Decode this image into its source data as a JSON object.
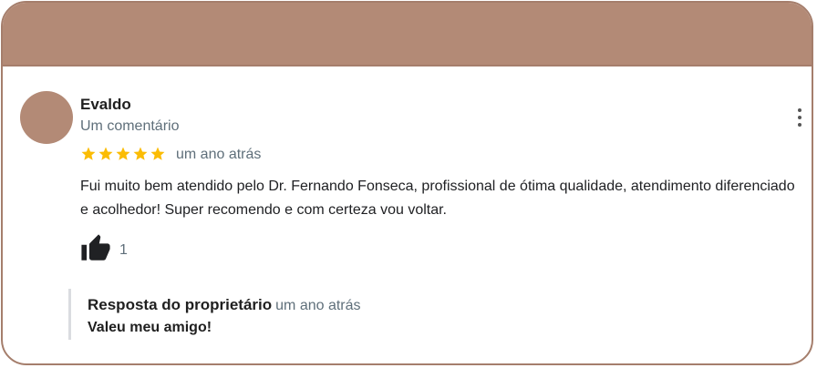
{
  "review": {
    "author": "Evaldo",
    "author_subtitle": "Um comentário",
    "rating": 5,
    "time": "um ano atrás",
    "text": "Fui muito bem atendido pelo Dr. Fernando Fonseca, profissional de ótima qualidade, atendimento diferenciado e acolhedor! Super recomendo e com certeza vou voltar.",
    "likes": "1",
    "icons": {
      "more": "more-vert-icon",
      "star": "star-icon",
      "like": "thumbs-up-icon"
    }
  },
  "owner_response": {
    "title": "Resposta do proprietário",
    "time": "um ano atrás",
    "text": "Valeu meu amigo!"
  },
  "colors": {
    "accent": "#b38a76",
    "border": "#a57e6c",
    "star": "#fbbc04",
    "secondary_text": "#5f6f7a"
  }
}
